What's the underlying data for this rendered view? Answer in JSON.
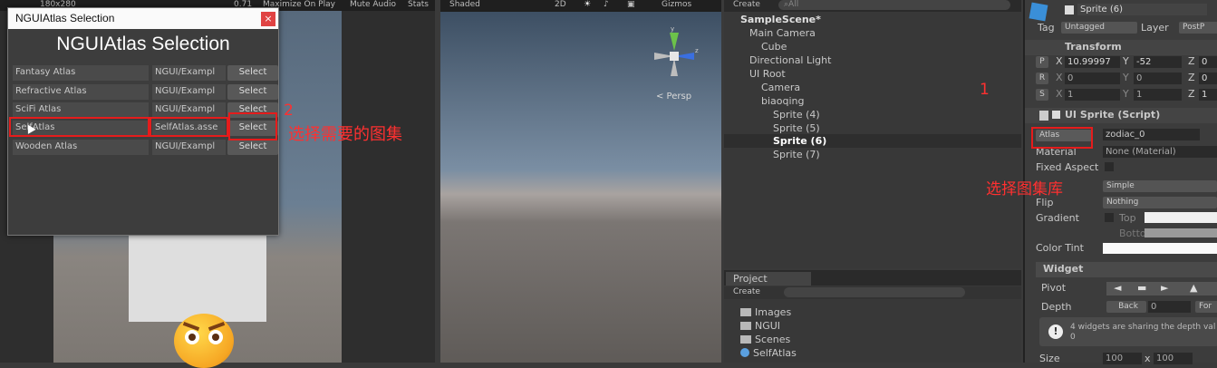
{
  "game_view": {
    "toolbar": {
      "res": "180x280",
      "zoom": "0.71",
      "maximize": "Maximize On Play",
      "mute": "Mute Audio",
      "stats": "Stats"
    }
  },
  "dialog": {
    "title": "NGUIAtlas Selection",
    "close": "×",
    "heading": "NGUIAtlas Selection",
    "rows": [
      {
        "name": "Fantasy Atlas",
        "path": "NGUI/Exampl",
        "button": "Select"
      },
      {
        "name": "Refractive Atlas",
        "path": "NGUI/Exampl",
        "button": "Select"
      },
      {
        "name": "SciFi Atlas",
        "path": "NGUI/Exampl",
        "button": "Select"
      },
      {
        "name": "SelfAtlas",
        "path": "SelfAtlas.asse",
        "button": "Select"
      },
      {
        "name": "Wooden Atlas",
        "path": "NGUI/Exampl",
        "button": "Select"
      }
    ]
  },
  "annotations": {
    "step2_number": "2",
    "step2_text": "选择需要的图集",
    "step1_number": "1",
    "step1_text": "选择图集库"
  },
  "scene_view": {
    "toolbar": {
      "shading": "Shaded",
      "mode2d": "2D",
      "gizmos": "Gizmos"
    },
    "persp": "< Persp"
  },
  "hierarchy": {
    "create": "Create",
    "search_placeholder": "All",
    "items": [
      {
        "label": "SampleScene*"
      },
      {
        "label": "Main Camera"
      },
      {
        "label": "Cube"
      },
      {
        "label": "Directional Light"
      },
      {
        "label": "UI Root"
      },
      {
        "label": "Camera"
      },
      {
        "label": "biaoqing"
      },
      {
        "label": "Sprite (4)"
      },
      {
        "label": "Sprite (5)"
      },
      {
        "label": "Sprite (6)"
      },
      {
        "label": "Sprite (7)"
      }
    ]
  },
  "project": {
    "tab": "Project",
    "create": "Create",
    "items": [
      {
        "label": "Images"
      },
      {
        "label": "NGUI"
      },
      {
        "label": "Scenes"
      },
      {
        "label": "SelfAtlas"
      }
    ]
  },
  "inspector": {
    "object_name": "Sprite (6)",
    "tag_label": "Tag",
    "tag_value": "Untagged",
    "layer_label": "Layer",
    "layer_value": "PostP",
    "transform_title": "Transform",
    "p_label": "P",
    "r_label": "R",
    "s_label": "S",
    "x": "X",
    "y": "Y",
    "z": "Z",
    "pos_x": "10.99997",
    "pos_y": "-52",
    "pos_z": "0",
    "rot_x": "0",
    "rot_y": "0",
    "rot_z": "0",
    "scale_x": "1",
    "scale_y": "1",
    "scale_z": "1",
    "uisprite_title": "UI Sprite (Script)",
    "atlas_button": "Atlas",
    "sprite_value": "zodiac_0",
    "material_label": "Material",
    "material_value": "None (Material)",
    "fixed_aspect_label": "Fixed Aspect",
    "type_value": "Simple",
    "flip_label": "Flip",
    "flip_value": "Nothing",
    "gradient_label": "Gradient",
    "top_label": "Top",
    "bottom_label": "Bottom",
    "color_tint_label": "Color Tint",
    "widget_title": "Widget",
    "pivot_label": "Pivot",
    "depth_label": "Depth",
    "back_button": "Back",
    "depth_value": "0",
    "forward_button": "For",
    "info_text": "4 widgets are sharing the depth val",
    "info_text2": "0",
    "size_label": "Size",
    "size_w": "100",
    "size_x": "x",
    "size_h": "100"
  }
}
